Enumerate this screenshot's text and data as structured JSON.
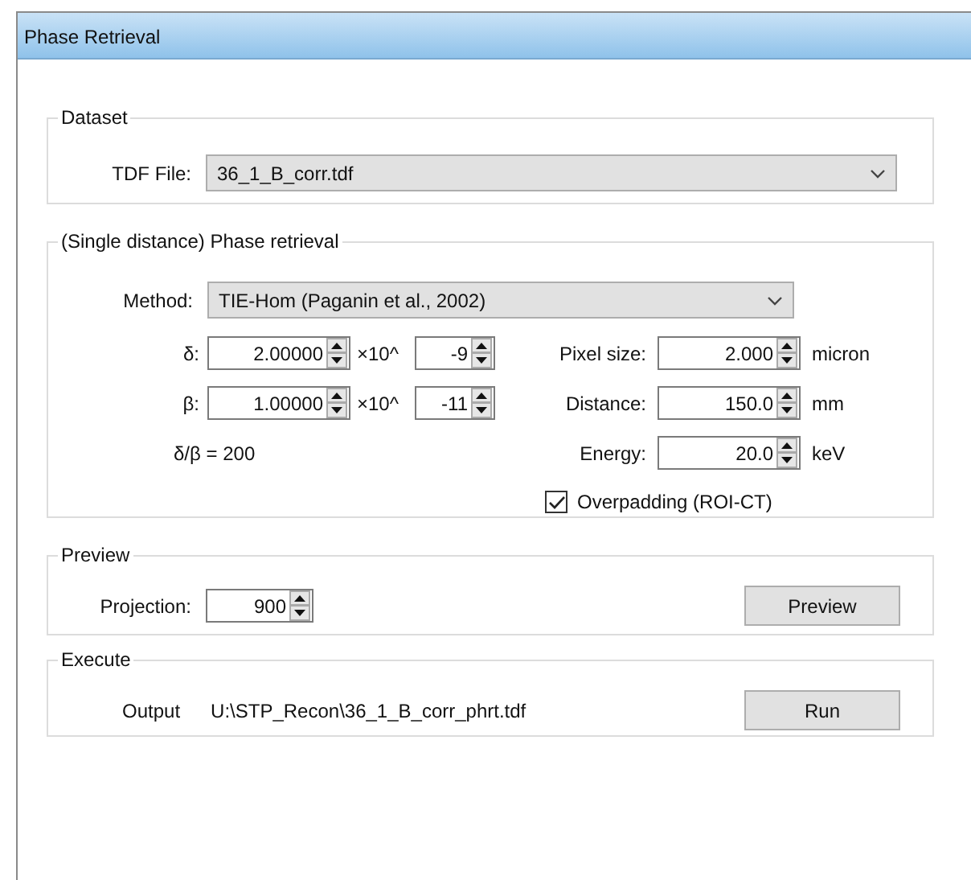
{
  "window": {
    "title": "Phase Retrieval"
  },
  "dataset": {
    "title": "Dataset",
    "tdf_file": {
      "label": "TDF File:",
      "value": "36_1_B_corr.tdf"
    }
  },
  "phase_retrieval": {
    "title": "(Single distance) Phase retrieval",
    "method": {
      "label": "Method:",
      "value": "TIE-Hom (Paganin et al., 2002)"
    },
    "left_rows": [
      {
        "label": "δ:",
        "mantissa": "2.00000",
        "times": "×10^",
        "exponent": "-9"
      },
      {
        "label": "β:",
        "mantissa": "1.00000",
        "times": "×10^",
        "exponent": "-11"
      }
    ],
    "ratio": "δ/β = 200",
    "right_rows": [
      {
        "label": "Pixel size:",
        "value": "2.000",
        "unit": "micron"
      },
      {
        "label": "Distance:",
        "value": "150.0",
        "unit": "mm"
      },
      {
        "label": "Energy:",
        "value": "20.0",
        "unit": "keV"
      }
    ],
    "overpadding": {
      "label": "Overpadding (ROI-CT)",
      "checked": true
    }
  },
  "preview": {
    "title": "Preview",
    "projection": {
      "label": "Projection:",
      "value": "900"
    },
    "button": "Preview"
  },
  "execute": {
    "title": "Execute",
    "output_label": "Output",
    "output_path": "U:\\STP_Recon\\36_1_B_corr_phrt.tdf",
    "button": "Run"
  }
}
